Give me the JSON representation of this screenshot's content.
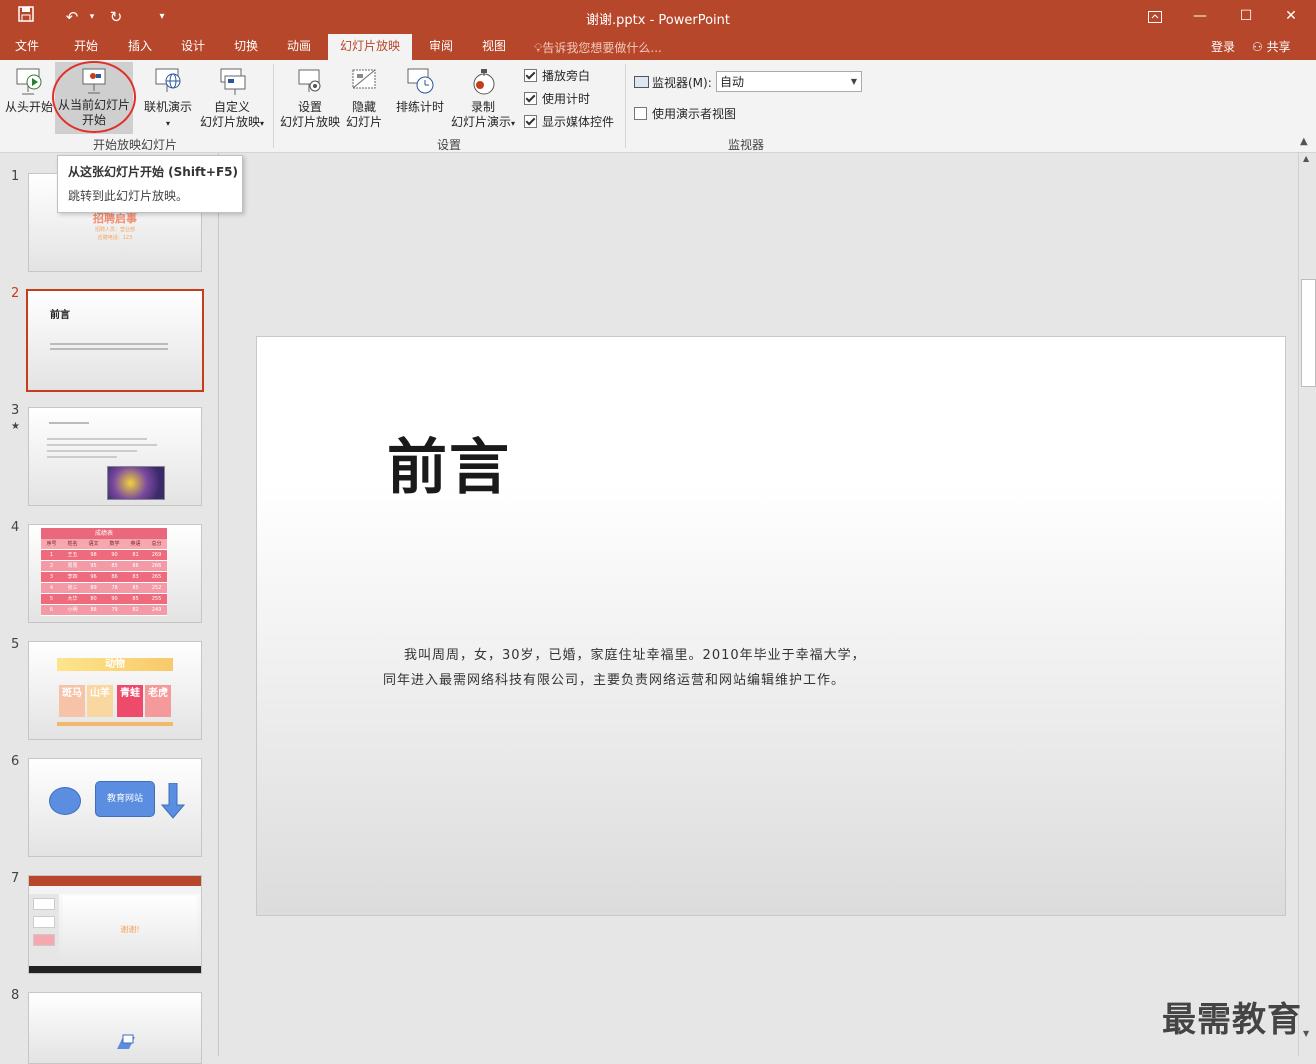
{
  "window": {
    "title": "谢谢.pptx - PowerPoint",
    "accent": "#b7472a"
  },
  "tabs": [
    "文件",
    "开始",
    "插入",
    "设计",
    "切换",
    "动画",
    "幻灯片放映",
    "审阅",
    "视图"
  ],
  "active_tab": "幻灯片放映",
  "tell_me": "告诉我您想要做什么...",
  "account": {
    "login": "登录",
    "share": "共享"
  },
  "ribbon": {
    "start_group": {
      "label": "开始放映幻灯片",
      "from_beginning": "从头开始",
      "from_current_l1": "从当前幻灯片",
      "from_current_l2": "开始",
      "online": "联机演示",
      "custom_l1": "自定义",
      "custom_l2": "幻灯片放映"
    },
    "setup_group": {
      "label": "设置",
      "setup_l1": "设置",
      "setup_l2": "幻灯片放映",
      "hide_l1": "隐藏",
      "hide_l2": "幻灯片",
      "rehearse": "排练计时",
      "record_l1": "录制",
      "record_l2": "幻灯片演示",
      "play_narrations": "播放旁白",
      "use_timings": "使用计时",
      "show_media": "显示媒体控件"
    },
    "monitor_group": {
      "label": "监视器",
      "monitor_label": "监视器(M):",
      "monitor_value": "自动",
      "presenter_view": "使用演示者视图"
    }
  },
  "tooltip": {
    "title": "从这张幻灯片开始 (Shift+F5)",
    "desc": "跳转到此幻灯片放映。"
  },
  "thumbnails": [
    {
      "num": "1",
      "title": "招聘启事",
      "line1": "招聘人员：营业部",
      "line2": "应聘电话：123"
    },
    {
      "num": "2",
      "title": "前言"
    },
    {
      "num": "3",
      "star": "★"
    },
    {
      "num": "4",
      "title": "成绩表",
      "headers": [
        "序号",
        "姓名",
        "语文",
        "数学",
        "英语",
        "总分"
      ],
      "rows": [
        [
          "1",
          "王五",
          "98",
          "90",
          "81",
          "269"
        ],
        [
          "2",
          "周周",
          "95",
          "85",
          "86",
          "266"
        ],
        [
          "3",
          "李四",
          "96",
          "86",
          "83",
          "265"
        ],
        [
          "4",
          "张三",
          "89",
          "78",
          "85",
          "252"
        ],
        [
          "5",
          "大华",
          "80",
          "90",
          "85",
          "255"
        ],
        [
          "6",
          "小明",
          "88",
          "79",
          "82",
          "249"
        ]
      ]
    },
    {
      "num": "5",
      "title": "动物",
      "cells": [
        "斑马",
        "山羊",
        "青蛙",
        "老虎"
      ]
    },
    {
      "num": "6",
      "box": "教育网站"
    },
    {
      "num": "7",
      "center": "谢谢!"
    },
    {
      "num": "8"
    }
  ],
  "slide": {
    "title": "前言",
    "body_line1": "我叫周周，女，30岁，已婚，家庭住址幸福里。2010年毕业于幸福大学，",
    "body_line2": "同年进入最需网络科技有限公司，主要负责网络运营和网站编辑维护工作。"
  },
  "watermark": "最需教育"
}
